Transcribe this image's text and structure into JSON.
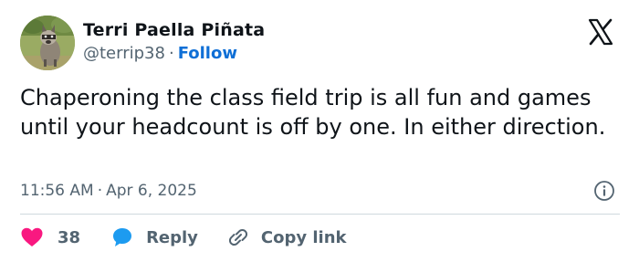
{
  "author": {
    "display_name": "Terri Paella Piñata",
    "handle": "@terrip38",
    "separator": "·",
    "follow_label": "Follow"
  },
  "tweet": {
    "text": "Chaperoning the class field trip is all fun and games until your headcount is off by one. In either direction.",
    "time": "11:56 AM",
    "separator": "·",
    "date": "Apr 6, 2025"
  },
  "actions": {
    "like_count": "38",
    "reply_label": "Reply",
    "copy_link_label": "Copy link"
  },
  "icons": {
    "brand": "x-logo-icon",
    "info": "info-icon",
    "like": "heart-icon",
    "reply": "speech-bubble-icon",
    "copy": "link-icon"
  },
  "colors": {
    "text_primary": "#0f1419",
    "text_secondary": "#536471",
    "link": "#0f6fd6",
    "heart": "#f91880",
    "reply_bubble": "#1d9bf0",
    "divider": "#cfd9de"
  }
}
